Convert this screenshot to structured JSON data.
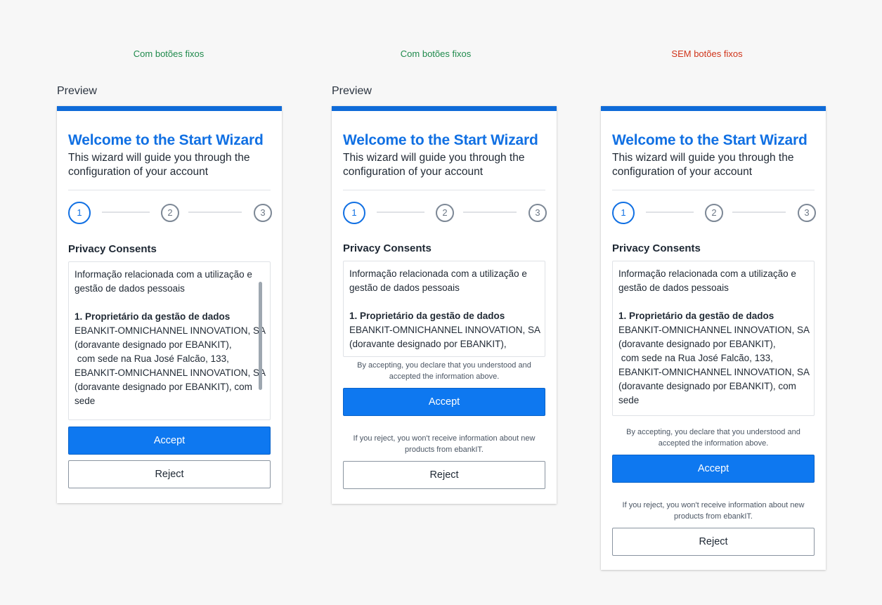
{
  "variants": [
    {
      "label": "Com botões fixos",
      "preview": "Preview"
    },
    {
      "label": "Com botões fixos",
      "preview": "Preview"
    },
    {
      "label": "SEM botões fixos",
      "preview": ""
    }
  ],
  "wizard": {
    "title": "Welcome to the Start Wizard",
    "subtitle": "This wizard will guide you through the configuration of your account",
    "steps": [
      "1",
      "2",
      "3"
    ],
    "active_step": 1,
    "section_title": "Privacy Consents"
  },
  "consent": {
    "intro": "Informação relacionada com a utilização e gestão de dados pessoais",
    "heading": "1. Proprietário da gestão de dados",
    "lines": [
      "EBANKIT-OMNICHANNEL INNOVATION, SA",
      "(doravante designado por EBANKIT),",
      " com sede na Rua José Falcão, 133,",
      "EBANKIT-OMNICHANNEL INNOVATION, SA",
      "(doravante designado por EBANKIT), com",
      "sede"
    ]
  },
  "accept_note": "By accepting, you declare that you understood and accepted the information above.",
  "reject_note": "If you reject, you won't receive information about new products from ebankIT.",
  "buttons": {
    "accept": "Accept",
    "reject": "Reject"
  },
  "colors": {
    "accent": "#1170e3",
    "primary_button": "#0e78f0",
    "top_bar": "#0f6bd8",
    "ok_label": "#1f8a4c",
    "bad_label": "#d0341a"
  }
}
